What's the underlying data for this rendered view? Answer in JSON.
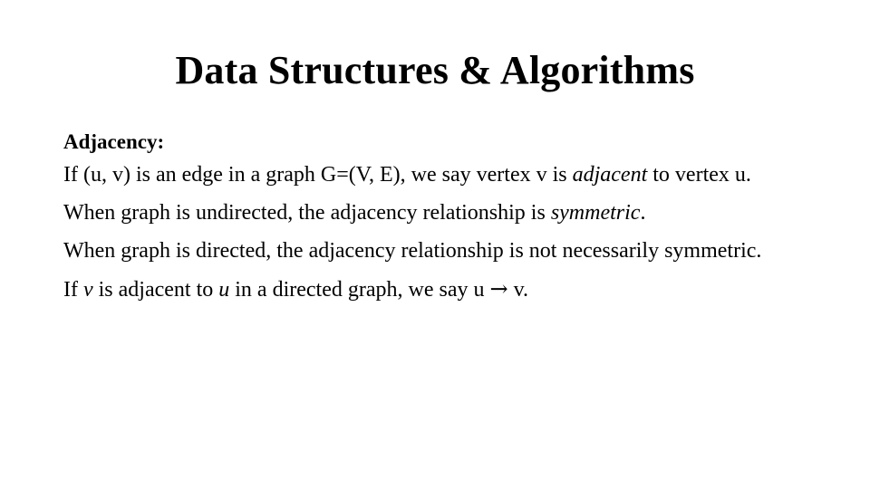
{
  "slide": {
    "title": "Data Structures & Algorithms",
    "heading": "Adjacency:",
    "paragraphs": {
      "p1": {
        "part1": "If (u, v) is an edge in a graph G=(V, E), we say vertex v is ",
        "emphasis": "adjacent",
        "part2": " to vertex u."
      },
      "p2": {
        "part1": "When graph is undirected, the adjacency relationship is ",
        "emphasis": "symmetric",
        "part2": "."
      },
      "p3": {
        "part1": "When graph is directed, the adjacency relationship is not necessarily symmetric."
      },
      "p4": {
        "part1": "If ",
        "emphasis1": "v",
        "part2": " is adjacent to ",
        "emphasis2": "u",
        "part3": " in a directed graph, we say u ",
        "arrow": "→",
        "part4": " v."
      }
    }
  },
  "colors": {
    "background": "#ffffff",
    "text": "#000000"
  }
}
